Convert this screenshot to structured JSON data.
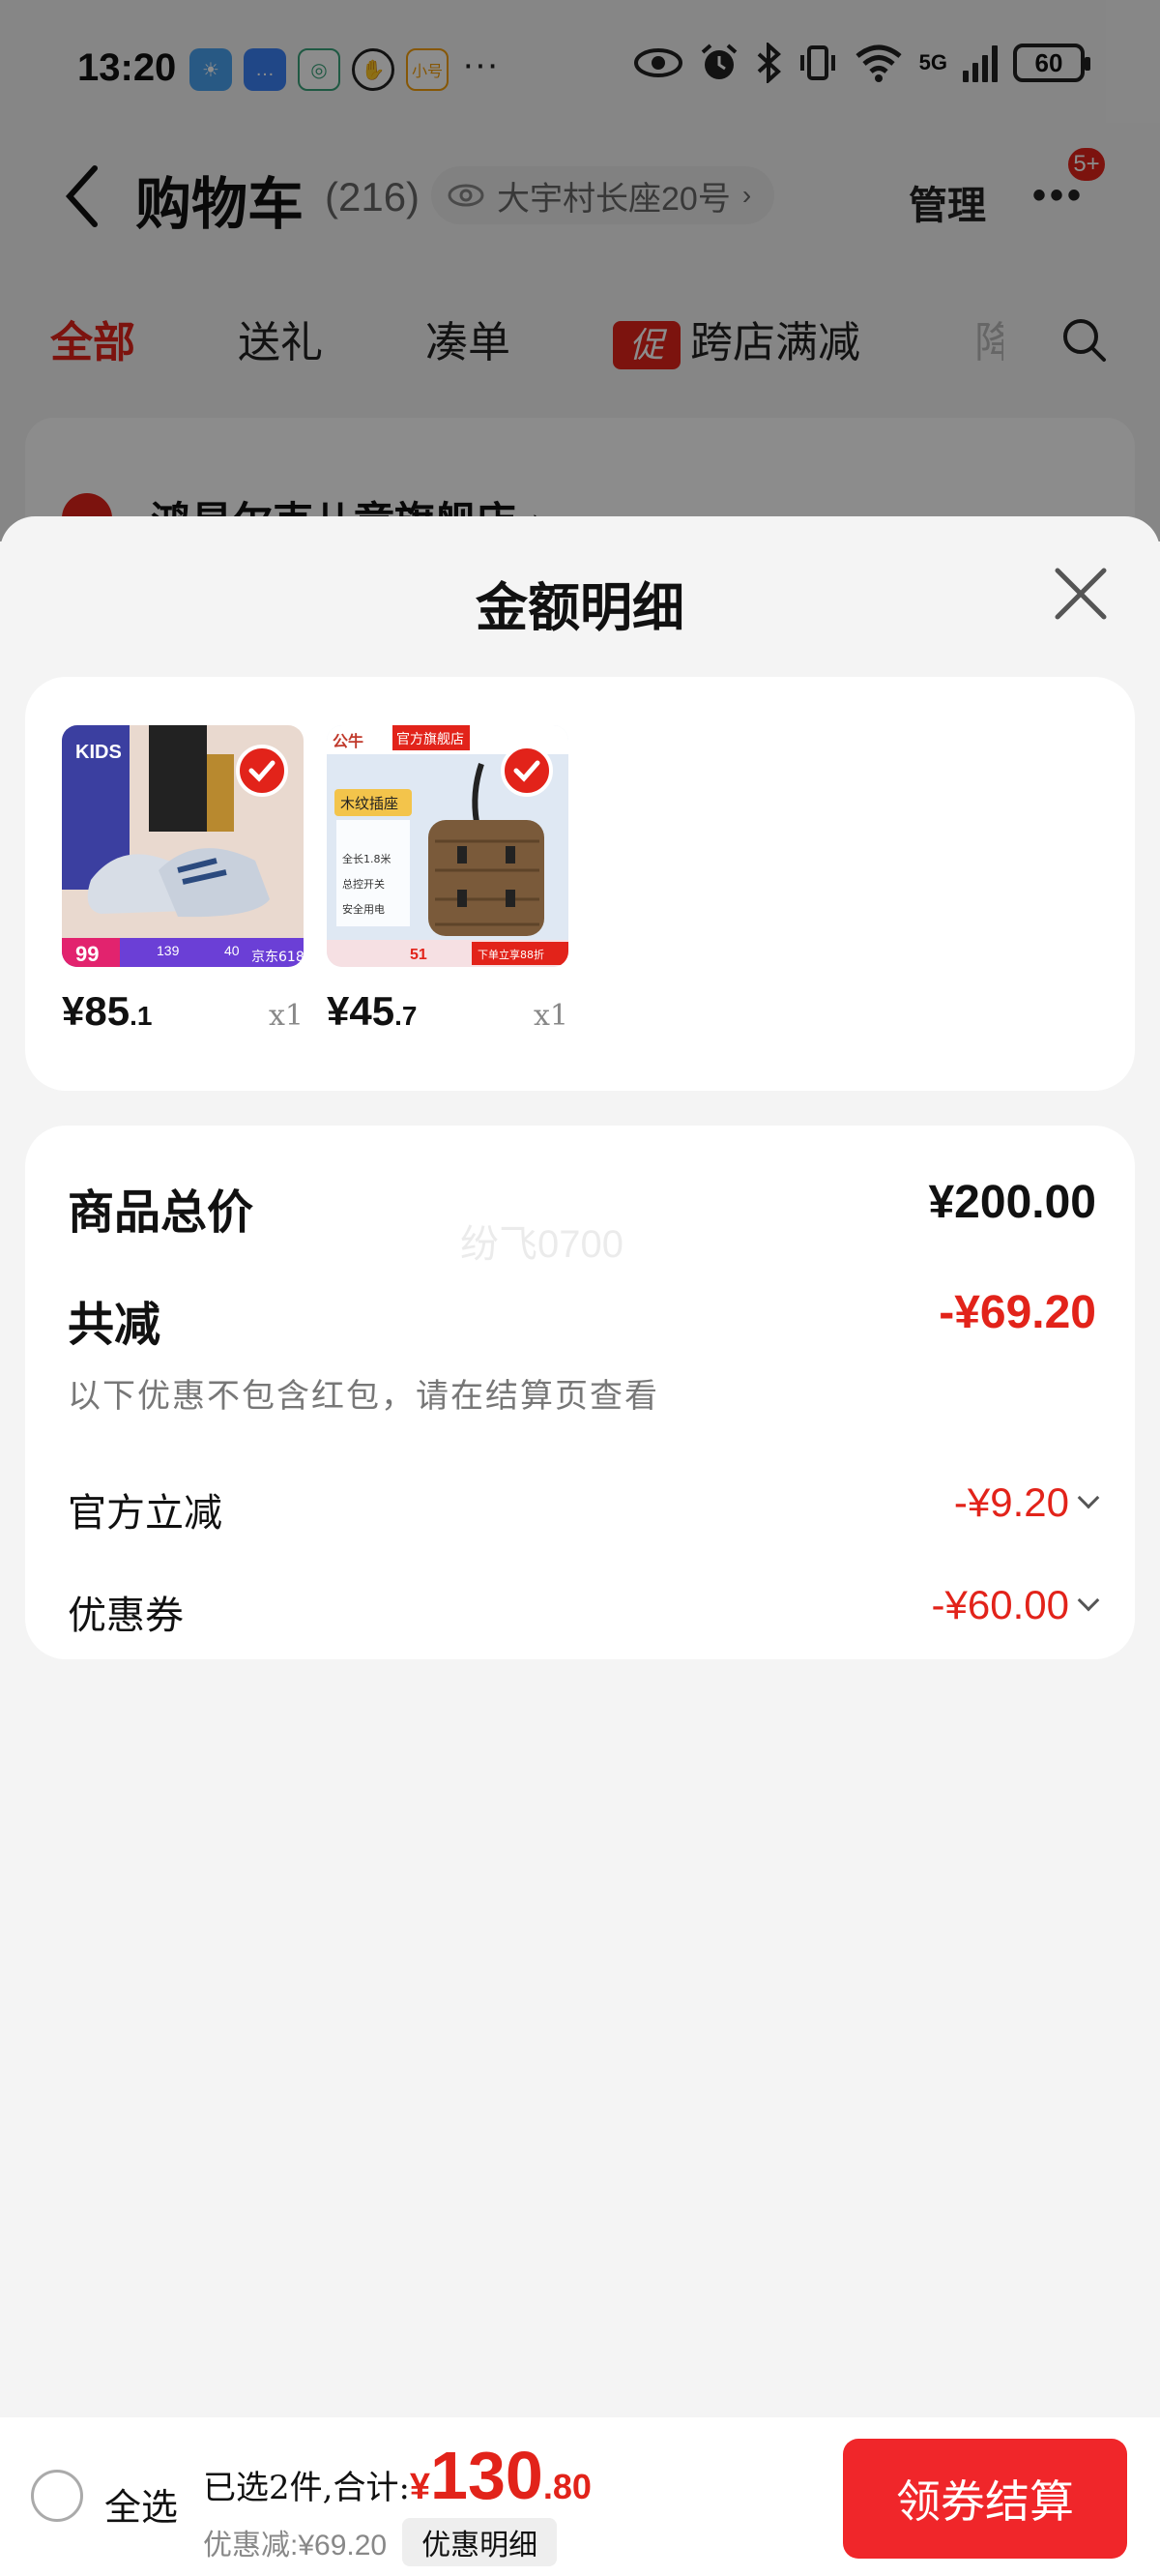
{
  "status_bar": {
    "time": "13:20",
    "more": "···",
    "network": "5G",
    "battery": "60",
    "app_icons": [
      "weather-icon",
      "messages-icon",
      "china-mobile-icon",
      "hand-icon",
      "xiaohe-icon"
    ],
    "xiaohe_label": "小号"
  },
  "header": {
    "title": "购物车",
    "count": "(216)",
    "address": "大宇村长座20号",
    "manage": "管理",
    "more": "•••",
    "badge": "5+"
  },
  "tabs": [
    {
      "label": "全部",
      "active": true
    },
    {
      "label": "送礼",
      "active": false
    },
    {
      "label": "凑单",
      "active": false
    },
    {
      "label": "跨店满减",
      "active": false,
      "tag": "促"
    },
    {
      "label": "降",
      "active": false
    }
  ],
  "store": {
    "name": "鸿星尔克儿童旗舰店 ›"
  },
  "sheet": {
    "title": "金额明细",
    "items": [
      {
        "price_int": "¥85",
        "price_dec": ".1",
        "qty": "x1",
        "image": "kids-shoes-image"
      },
      {
        "price_int": "¥45",
        "price_dec": ".7",
        "qty": "x1",
        "image": "wood-socket-image"
      }
    ],
    "thumb_text": {
      "shoe_brand": "KIDS",
      "shoe_price": "99",
      "shoe_price2": "139",
      "shoe_price3": "40",
      "shoe_jd": "京东618",
      "socket_brand": "公牛",
      "socket_flag": "官方旗舰店",
      "socket_title": "木纹插座",
      "socket_feature1": "全长1.8米",
      "socket_feature2": "总控开关",
      "socket_feature3": "安全用电",
      "socket_price": "51",
      "socket_promo": "下单立享88折"
    },
    "total_label": "商品总价",
    "total_value": "¥200.00",
    "watermark": "纷飞0700",
    "reduce_label": "共减",
    "reduce_value": "-¥69.20",
    "note": "以下优惠不包含红包，请在结算页查看",
    "official_label": "官方立减",
    "official_value": "-¥9.20",
    "coupon_label": "优惠券",
    "coupon_value": "-¥60.00"
  },
  "bottom": {
    "select_all": "全选",
    "summary": "已选2件,合计:",
    "yen": "¥",
    "total_int": "130",
    "total_dec": ".80",
    "discount": "优惠减:¥69.20",
    "detail_btn": "优惠明细",
    "checkout": "领券结算"
  },
  "colors": {
    "accent": "#e2231a",
    "checkout": "#f0262a"
  }
}
